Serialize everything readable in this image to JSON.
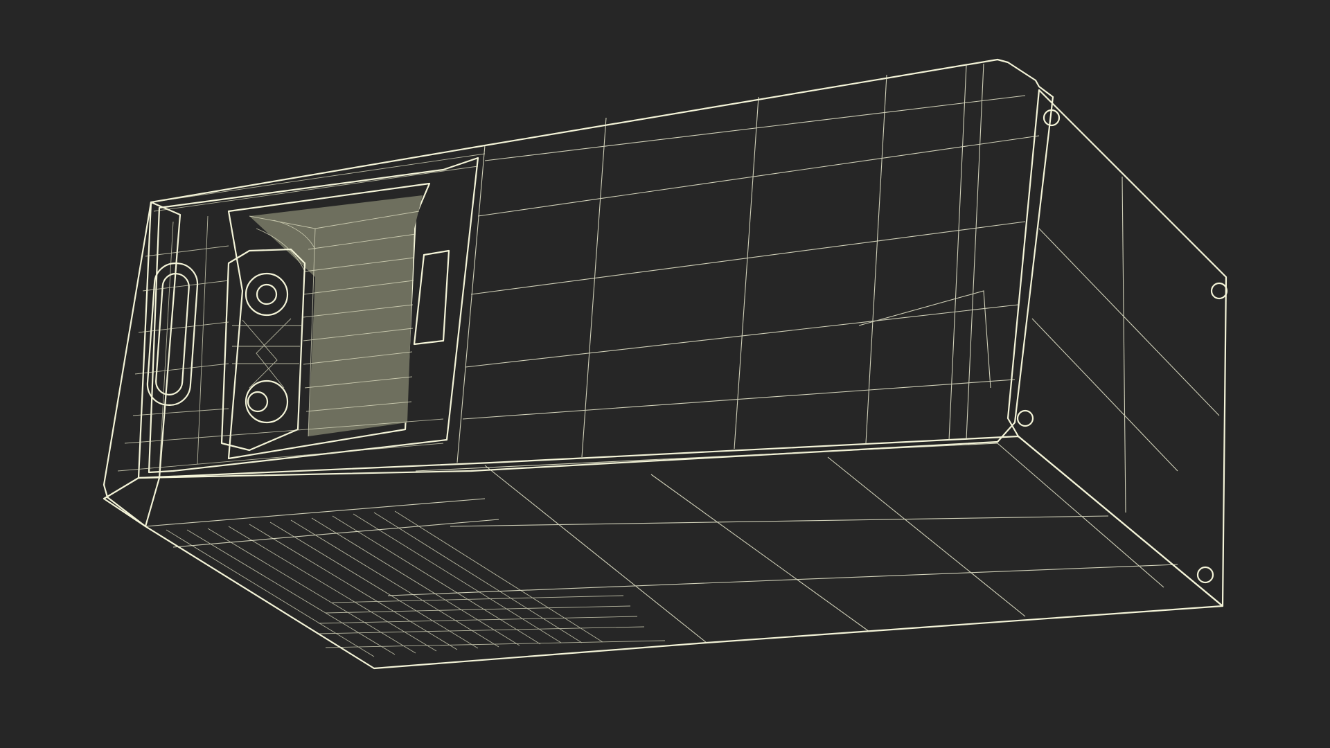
{
  "scene": {
    "background_color": "#262626",
    "mesh_fill_color": "#7e7f6d",
    "wire_color": "#f4f4d8"
  },
  "objects": [
    {
      "name": "wireframe-device-render",
      "icon": "3d-wireframe-box"
    }
  ]
}
